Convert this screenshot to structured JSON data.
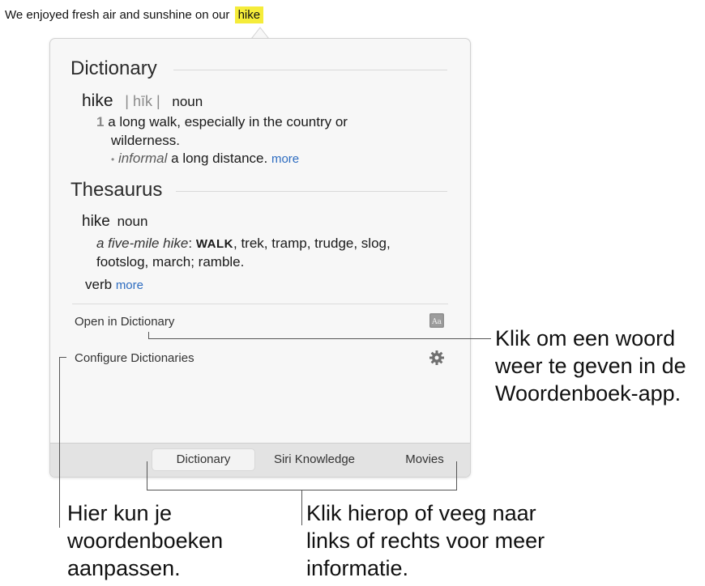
{
  "sentence": {
    "prefix": "We enjoyed fresh air and sunshine on our",
    "highlight": "hike"
  },
  "dictionary": {
    "section_title": "Dictionary",
    "headword": "hike",
    "pronunciation": "| hīk |",
    "pos": "noun",
    "sense_number": "1",
    "definition_line1": "a long walk, especially in the country or",
    "definition_line2": "wilderness.",
    "bullet": "•",
    "sub_label": "informal",
    "sub_text": "a long distance.",
    "more": "more"
  },
  "thesaurus": {
    "section_title": "Thesaurus",
    "headword": "hike",
    "pos": "noun",
    "example": "a five-mile hike",
    "colon": ":",
    "main_synonym": "WALK",
    "synonyms_line1": ", trek, tramp, trudge, slog,",
    "synonyms_line2": "footslog, march; ramble.",
    "verb_label": "verb",
    "more": "more"
  },
  "footer": {
    "open_label": "Open in Dictionary",
    "configure_label": "Configure Dictionaries"
  },
  "tabs": [
    {
      "label": "Dictionary",
      "active": true
    },
    {
      "label": "Siri Knowledge",
      "active": false
    },
    {
      "label": "Movies",
      "active": false
    }
  ],
  "callouts": {
    "open_app": [
      "Klik om een woord",
      "weer te geven in de",
      "Woordenboek-app."
    ],
    "configure": [
      "Hier kun je",
      "woordenboeken",
      "aanpassen."
    ],
    "tabs": [
      "Klik hierop of veeg naar",
      "links of rechts voor meer",
      "informatie."
    ]
  },
  "colors": {
    "highlight": "#f5ec3a",
    "link": "#2d6cc0",
    "tabbar": "#e3e3e3"
  }
}
